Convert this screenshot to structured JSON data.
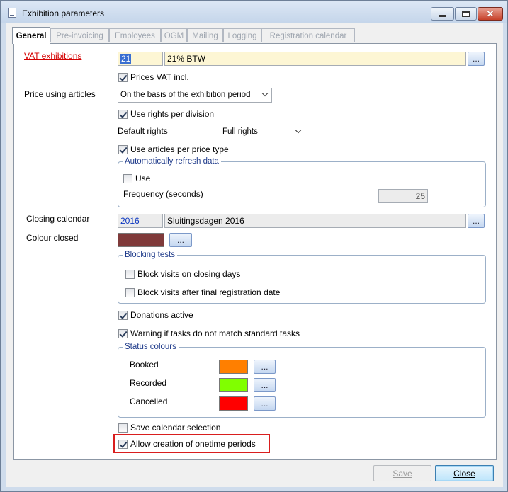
{
  "window": {
    "title": "Exhibition parameters"
  },
  "tabs": [
    {
      "label": "General",
      "active": true
    },
    {
      "label": "Pre-invoicing"
    },
    {
      "label": "Employees"
    },
    {
      "label": "OGM"
    },
    {
      "label": "Mailing"
    },
    {
      "label": "Logging"
    },
    {
      "label": "Registration calendar"
    }
  ],
  "vat": {
    "label": "VAT exhibitions",
    "code": "21",
    "description": "21% BTW",
    "browse": "..."
  },
  "prices_vat_incl": {
    "label": "Prices VAT incl.",
    "checked": true
  },
  "price_using_articles": {
    "label": "Price using articles",
    "value": "On the basis of the exhibition period"
  },
  "use_rights_per_division": {
    "label": "Use rights per division",
    "checked": true
  },
  "default_rights": {
    "label": "Default rights",
    "value": "Full rights"
  },
  "use_articles_per_price_type": {
    "label": "Use articles per price type",
    "checked": true
  },
  "auto_refresh": {
    "legend": "Automatically refresh data",
    "use_label": "Use",
    "use_checked": false,
    "frequency_label": "Frequency (seconds)",
    "frequency_value": "25"
  },
  "closing_calendar": {
    "label": "Closing calendar",
    "code": "2016",
    "description": "Sluitingsdagen 2016",
    "browse": "..."
  },
  "colour_closed": {
    "label": "Colour closed",
    "color": "#7f3a3a",
    "browse": "..."
  },
  "blocking_tests": {
    "legend": "Blocking tests",
    "closing_days_label": "Block visits on closing days",
    "closing_days_checked": false,
    "final_date_label": "Block visits after final registration date",
    "final_date_checked": false
  },
  "donations_active": {
    "label": "Donations active",
    "checked": true
  },
  "warning_tasks": {
    "label": "Warning if tasks do not match standard tasks",
    "checked": true
  },
  "status_colours": {
    "legend": "Status colours",
    "items": [
      {
        "label": "Booked",
        "color": "#ff7f00",
        "browse": "..."
      },
      {
        "label": "Recorded",
        "color": "#80ff00",
        "browse": "..."
      },
      {
        "label": "Cancelled",
        "color": "#ff0000",
        "browse": "..."
      }
    ]
  },
  "save_calendar_selection": {
    "label": "Save calendar selection",
    "checked": false
  },
  "allow_onetime_periods": {
    "label": "Allow creation of onetime periods",
    "checked": true
  },
  "footer": {
    "save_label": "Save",
    "close_label": "Close"
  },
  "colors": {
    "link_red": "#d40000",
    "highlight_red": "#d91e1e",
    "group_legend": "#1e3a8a",
    "field_yellow": "#fdf6d4"
  }
}
